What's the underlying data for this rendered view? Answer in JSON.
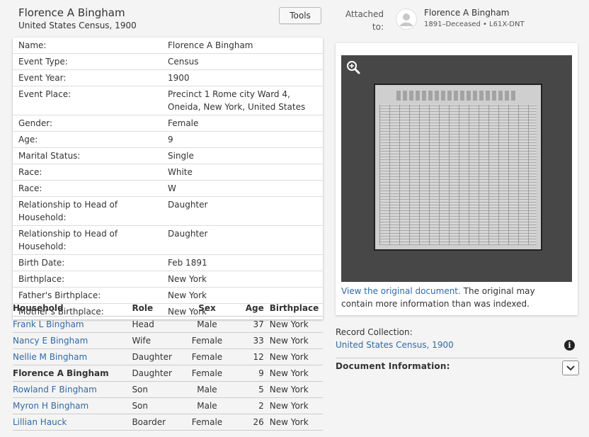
{
  "header": {
    "title": "Florence A Bingham",
    "subtitle": "United States Census, 1900",
    "tools_label": "Tools"
  },
  "facts": [
    {
      "label": "Name:",
      "value": "Florence A Bingham"
    },
    {
      "label": "Event Type:",
      "value": "Census"
    },
    {
      "label": "Event Year:",
      "value": "1900"
    },
    {
      "label": "Event Place:",
      "value": "Precinct 1 Rome city Ward 4, Oneida, New York, United States"
    },
    {
      "label": "Gender:",
      "value": "Female"
    },
    {
      "label": "Age:",
      "value": "9"
    },
    {
      "label": "Marital Status:",
      "value": "Single"
    },
    {
      "label": "Race:",
      "value": "White"
    },
    {
      "label": "Race:",
      "value": "W"
    },
    {
      "label": "Relationship to Head of Household:",
      "value": "Daughter"
    },
    {
      "label": "Relationship to Head of Household:",
      "value": "Daughter"
    },
    {
      "label": "Birth Date:",
      "value": "Feb 1891"
    },
    {
      "label": "Birthplace:",
      "value": "New York"
    },
    {
      "label": "Father's Birthplace:",
      "value": "New York"
    },
    {
      "label": "Mother's Birthplace:",
      "value": "New York"
    }
  ],
  "household": {
    "headers": {
      "name": "Household",
      "role": "Role",
      "sex": "Sex",
      "age": "Age",
      "birthplace": "Birthplace"
    },
    "rows": [
      {
        "name": "Frank L Bingham",
        "role": "Head",
        "sex": "Male",
        "age": "37",
        "birthplace": "New York",
        "current": false
      },
      {
        "name": "Nancy E Bingham",
        "role": "Wife",
        "sex": "Female",
        "age": "33",
        "birthplace": "New York",
        "current": false
      },
      {
        "name": "Nellie M Bingham",
        "role": "Daughter",
        "sex": "Female",
        "age": "12",
        "birthplace": "New York",
        "current": false
      },
      {
        "name": "Florence A Bingham",
        "role": "Daughter",
        "sex": "Female",
        "age": "9",
        "birthplace": "New York",
        "current": true
      },
      {
        "name": "Rowland F Bingham",
        "role": "Son",
        "sex": "Male",
        "age": "5",
        "birthplace": "New York",
        "current": false
      },
      {
        "name": "Myron H Bingham",
        "role": "Son",
        "sex": "Male",
        "age": "2",
        "birthplace": "New York",
        "current": false
      },
      {
        "name": "Lillian Hauck",
        "role": "Boarder",
        "sex": "Female",
        "age": "26",
        "birthplace": "New York",
        "current": false
      }
    ]
  },
  "attached": {
    "label": "Attached to:",
    "name": "Florence A Bingham",
    "meta": "1891–Deceased • L61X-DNT",
    "avatar_icon": "person-avatar-icon"
  },
  "viewer": {
    "zoom_icon": "zoom-in-icon",
    "link_text": "View the original document.",
    "note_text": " The original may contain more information than was indexed."
  },
  "record_collection": {
    "label": "Record Collection:",
    "link": "United States Census, 1900"
  },
  "document_information": {
    "label": "Document Information:",
    "toggle_icon": "chevron-down-icon"
  },
  "colors": {
    "link": "#2f6aa8",
    "viewer_bg": "#474747",
    "page_bg": "#f4f4f4"
  }
}
